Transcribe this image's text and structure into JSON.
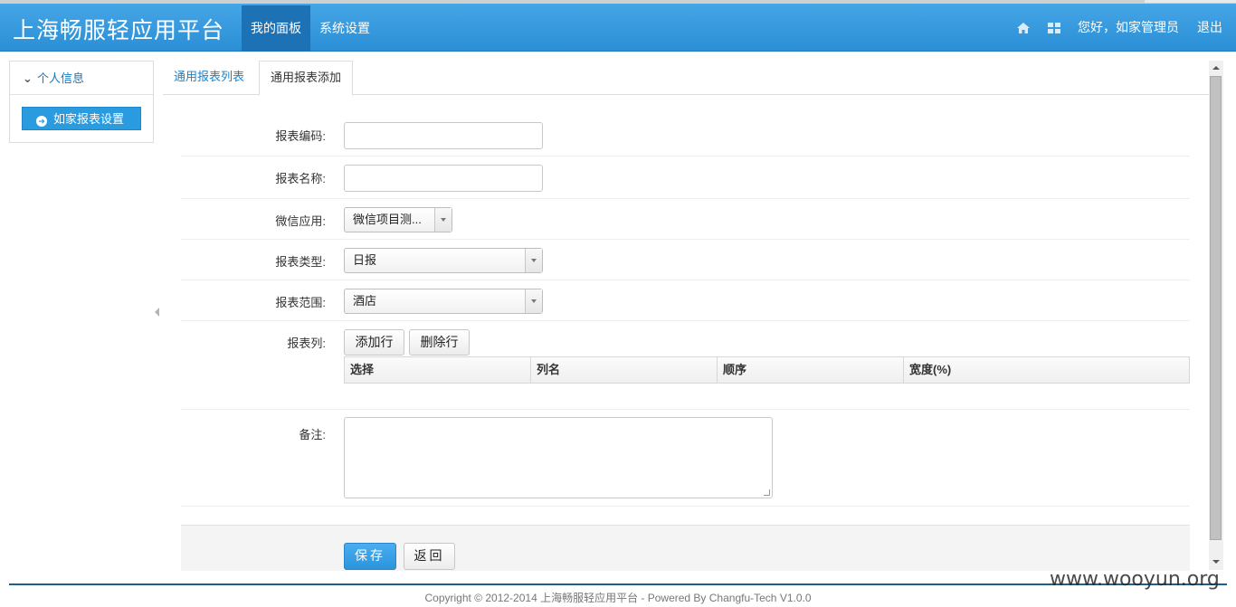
{
  "brand": "上海畅服轻应用平台",
  "nav": {
    "items": [
      {
        "label": "我的面板",
        "active": true
      },
      {
        "label": "系统设置",
        "active": false
      }
    ],
    "greeting": "您好，如家管理员",
    "logout": "退出",
    "icons": [
      "home-icon",
      "grid-icon"
    ]
  },
  "sidebar": {
    "section": "个人信息",
    "item": "如家报表设置"
  },
  "tabs": [
    {
      "label": "通用报表列表",
      "active": false
    },
    {
      "label": "通用报表添加",
      "active": true
    }
  ],
  "form": {
    "code_label": "报表编码:",
    "code_value": "",
    "name_label": "报表名称:",
    "name_value": "",
    "app_label": "微信应用:",
    "app_value": "微信项目测...",
    "type_label": "报表类型:",
    "type_value": "日报",
    "scope_label": "报表范围:",
    "scope_value": "酒店",
    "columns_label": "报表列:",
    "add_row": "添加行",
    "delete_row": "删除行",
    "grid_headers": [
      "选择",
      "列名",
      "顺序",
      "宽度(%)"
    ],
    "remark_label": "备注:",
    "remark_value": ""
  },
  "actions": {
    "save": "保存",
    "back": "返回"
  },
  "footer": "Copyright © 2012-2014 上海畅服轻应用平台 - Powered By Changfu-Tech V1.0.0",
  "watermark": "www.wooyun.org",
  "colors": {
    "navbar": "#2b8fd6",
    "nav_active": "#1c72b5",
    "primary_button": "#2b94dc",
    "link": "#1a82c8"
  }
}
